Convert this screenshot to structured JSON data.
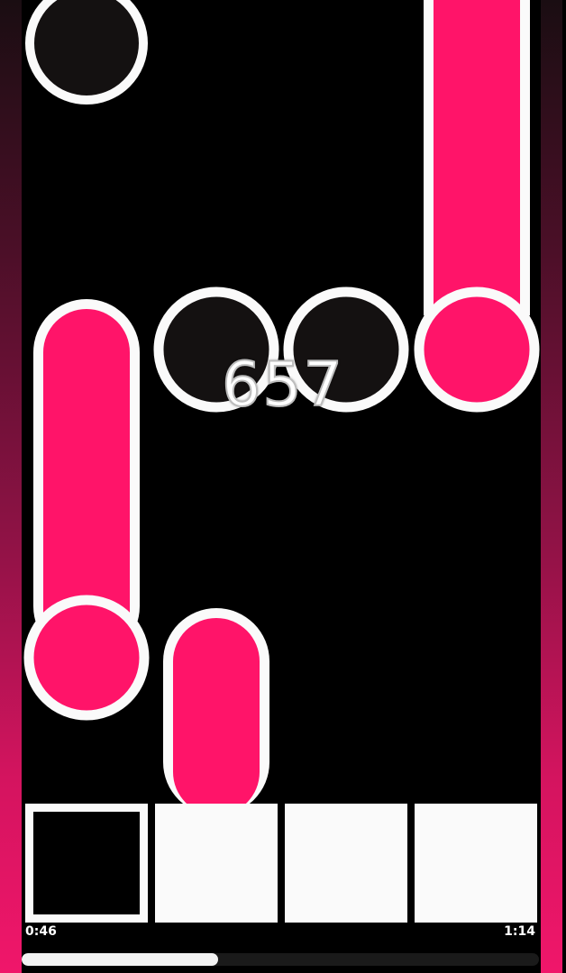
{
  "score": "657",
  "time": {
    "elapsed": "0:46",
    "total": "1:14"
  },
  "progress": 0.38,
  "colors": {
    "accent": "#ff1469",
    "outline": "#fafafa",
    "background": "#000000",
    "empty_circle": "#141111"
  },
  "lanes": 4,
  "keys": [
    {
      "state": "pressed"
    },
    {
      "state": "idle"
    },
    {
      "state": "idle"
    },
    {
      "state": "idle"
    }
  ]
}
